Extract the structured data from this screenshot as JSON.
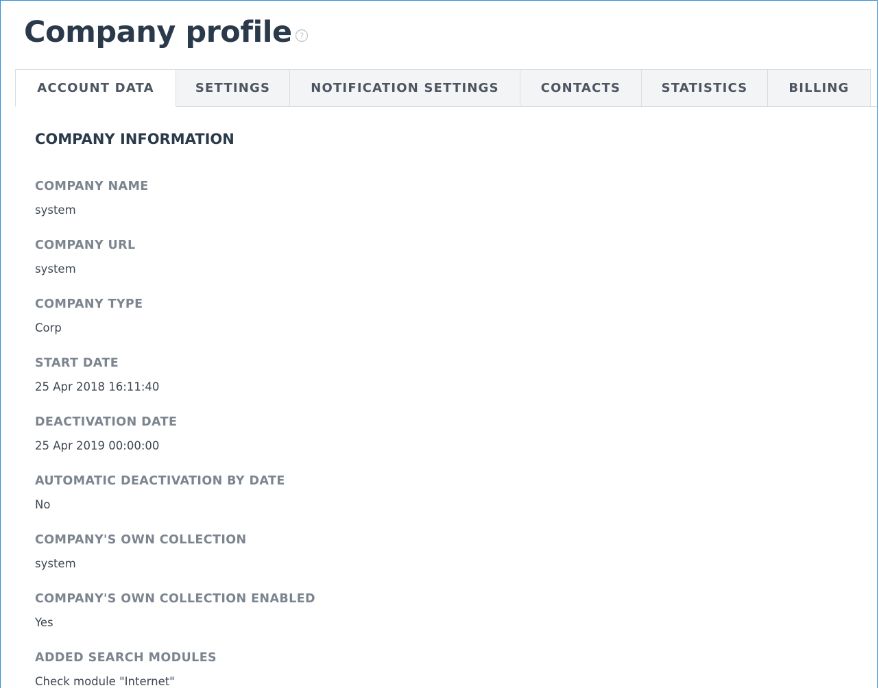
{
  "page": {
    "title": "Company profile"
  },
  "tabs": [
    {
      "label": "ACCOUNT DATA",
      "active": true
    },
    {
      "label": "SETTINGS",
      "active": false
    },
    {
      "label": "NOTIFICATION SETTINGS",
      "active": false
    },
    {
      "label": "CONTACTS",
      "active": false
    },
    {
      "label": "STATISTICS",
      "active": false
    },
    {
      "label": "BILLING",
      "active": false
    }
  ],
  "section": {
    "title": "COMPANY INFORMATION"
  },
  "fields": [
    {
      "label": "COMPANY NAME",
      "value": "system"
    },
    {
      "label": "COMPANY URL",
      "value": "system"
    },
    {
      "label": "COMPANY TYPE",
      "value": "Corp"
    },
    {
      "label": "START DATE",
      "value": "25 Apr 2018 16:11:40"
    },
    {
      "label": "DEACTIVATION DATE",
      "value": "25 Apr 2019 00:00:00"
    },
    {
      "label": "AUTOMATIC DEACTIVATION BY DATE",
      "value": "No"
    },
    {
      "label": "COMPANY'S OWN COLLECTION",
      "value": "system"
    },
    {
      "label": "COMPANY'S OWN COLLECTION ENABLED",
      "value": "Yes"
    },
    {
      "label": "ADDED SEARCH MODULES",
      "value": "Check module \"Internet\""
    }
  ],
  "icons": {
    "help": "question-circle-icon"
  },
  "colors": {
    "frame_border": "#2e8bd6",
    "title": "#2b3a4b",
    "label": "#7c858f",
    "value": "#3e4650",
    "tab_bg": "#f3f4f5"
  }
}
